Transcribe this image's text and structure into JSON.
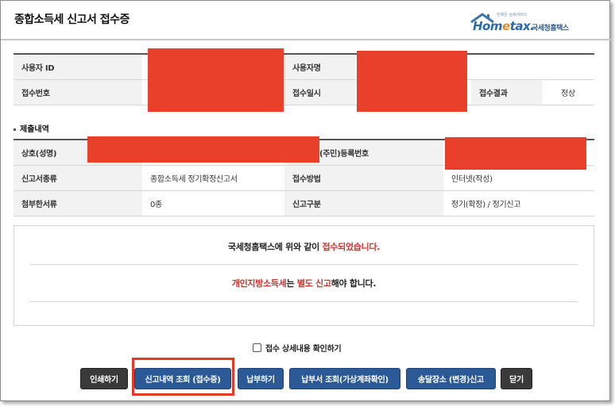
{
  "header": {
    "title": "종합소득세 신고서 접수증",
    "logo_tagline": "언제든 실세서비스",
    "logo_home_pre": "Hom",
    "logo_home_e": "e",
    "logo_home_post": "tax.",
    "logo_korean": "국세청홈택스"
  },
  "receipt": {
    "user_id_label": "사용자 ID",
    "user_name_label": "사용자명",
    "receipt_no_label": "접수번호",
    "receipt_date_label": "접수일시",
    "result_label": "접수결과",
    "result_value": "정상"
  },
  "submission": {
    "section_title": "제출내역",
    "trade_name_label": "상호(성명)",
    "reg_no_label": "(주민)등록번호",
    "report_type_label": "신고서종류",
    "report_type_value": "종합소득세 정기확정신고서",
    "method_label": "접수방법",
    "method_value": "인터넷(작성)",
    "attach_label": "첨부한서류",
    "attach_value": "0종",
    "category_label": "신고구분",
    "category_value": "정기(확정) / 정기신고"
  },
  "notice": {
    "line1_pre": "국세청홈택스에 위와 같이 ",
    "line1_red": "접수되었습니다.",
    "line2_red1": "개인지방소득세",
    "line2_mid": "는 ",
    "line2_red2": "별도 신고",
    "line2_post": "해야 합니다."
  },
  "checkbox": {
    "label": "접수 상세내용 확인하기",
    "checked": false
  },
  "buttons": {
    "print": "인쇄하기",
    "view_history": "신고내역 조회 (접수증)",
    "pay": "납부하기",
    "pay_slip": "납부서 조회(가상계좌확인)",
    "mailing": "송달장소 (변경)신고",
    "close": "닫기"
  },
  "colors": {
    "redaction": "#e8402a",
    "highlight": "#e23a24",
    "button_blue": "#2b5a97",
    "button_dark": "#3a3a3a",
    "notice_red": "#d2322d"
  }
}
